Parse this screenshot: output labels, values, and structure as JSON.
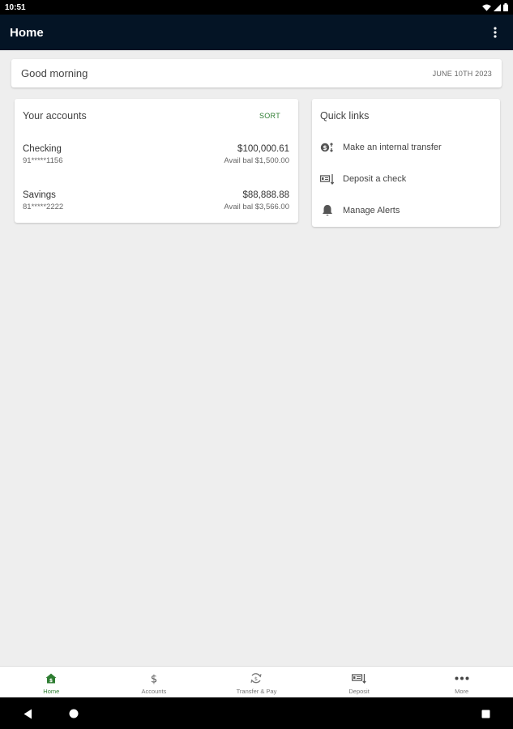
{
  "status_bar": {
    "time": "10:51"
  },
  "app_bar": {
    "title": "Home"
  },
  "greeting": {
    "text": "Good morning",
    "date": "JUNE 10TH 2023"
  },
  "accounts": {
    "title": "Your accounts",
    "sort_label": "SORT",
    "items": [
      {
        "name": "Checking",
        "number": "91*****1156",
        "balance": "$100,000.61",
        "available": "Avail bal $1,500.00"
      },
      {
        "name": "Savings",
        "number": "81*****2222",
        "balance": "$88,888.88",
        "available": "Avail bal $3,566.00"
      }
    ]
  },
  "quick_links": {
    "title": "Quick links",
    "items": [
      {
        "label": "Make an internal transfer",
        "icon": "transfer-icon"
      },
      {
        "label": "Deposit a check",
        "icon": "check-deposit-icon"
      },
      {
        "label": "Manage Alerts",
        "icon": "bell-icon"
      }
    ]
  },
  "bottom_nav": {
    "items": [
      {
        "label": "Home",
        "icon": "home-icon",
        "active": true
      },
      {
        "label": "Accounts",
        "icon": "dollar-icon",
        "active": false
      },
      {
        "label": "Transfer & Pay",
        "icon": "transfer-pay-icon",
        "active": false
      },
      {
        "label": "Deposit",
        "icon": "deposit-icon",
        "active": false
      },
      {
        "label": "More",
        "icon": "more-icon",
        "active": false
      }
    ]
  },
  "colors": {
    "app_bar": "#041425",
    "accent": "#2e7d32",
    "background": "#eeeeee"
  }
}
